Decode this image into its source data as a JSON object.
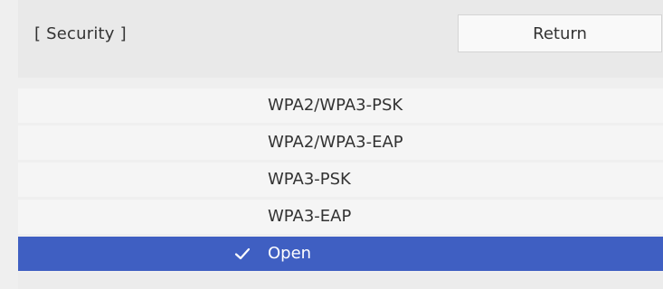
{
  "header": {
    "title": "[ Security ]",
    "return_label": "Return"
  },
  "list": {
    "items": [
      {
        "label": "WPA2/WPA3-PSK",
        "selected": false
      },
      {
        "label": "WPA2/WPA3-EAP",
        "selected": false
      },
      {
        "label": "WPA3-PSK",
        "selected": false
      },
      {
        "label": "WPA3-EAP",
        "selected": false
      },
      {
        "label": "Open",
        "selected": true
      }
    ],
    "selected_icon": "checkmark-icon"
  },
  "colors": {
    "selected_background": "#3f5fc2",
    "selected_text": "#ffffff",
    "text": "#333333"
  }
}
